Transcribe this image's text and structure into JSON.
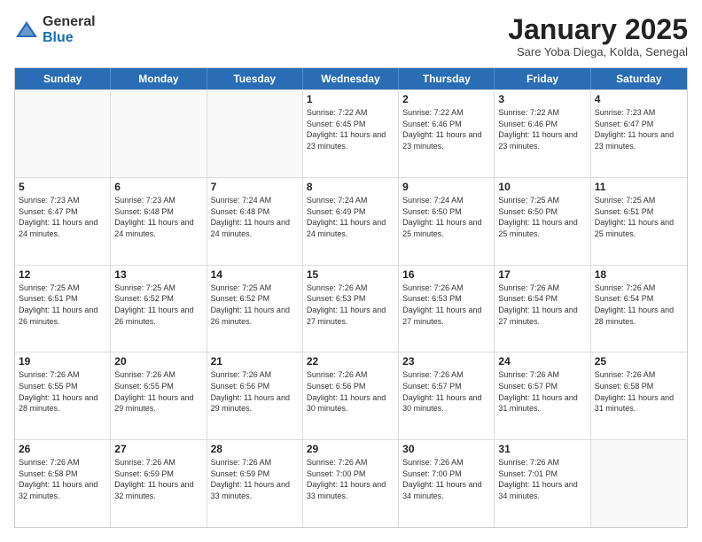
{
  "logo": {
    "general": "General",
    "blue": "Blue"
  },
  "header": {
    "title": "January 2025",
    "location": "Sare Yoba Diega, Kolda, Senegal"
  },
  "days": [
    "Sunday",
    "Monday",
    "Tuesday",
    "Wednesday",
    "Thursday",
    "Friday",
    "Saturday"
  ],
  "weeks": [
    [
      {
        "num": "",
        "info": ""
      },
      {
        "num": "",
        "info": ""
      },
      {
        "num": "",
        "info": ""
      },
      {
        "num": "1",
        "info": "Sunrise: 7:22 AM\nSunset: 6:45 PM\nDaylight: 11 hours and 23 minutes."
      },
      {
        "num": "2",
        "info": "Sunrise: 7:22 AM\nSunset: 6:46 PM\nDaylight: 11 hours and 23 minutes."
      },
      {
        "num": "3",
        "info": "Sunrise: 7:22 AM\nSunset: 6:46 PM\nDaylight: 11 hours and 23 minutes."
      },
      {
        "num": "4",
        "info": "Sunrise: 7:23 AM\nSunset: 6:47 PM\nDaylight: 11 hours and 23 minutes."
      }
    ],
    [
      {
        "num": "5",
        "info": "Sunrise: 7:23 AM\nSunset: 6:47 PM\nDaylight: 11 hours and 24 minutes."
      },
      {
        "num": "6",
        "info": "Sunrise: 7:23 AM\nSunset: 6:48 PM\nDaylight: 11 hours and 24 minutes."
      },
      {
        "num": "7",
        "info": "Sunrise: 7:24 AM\nSunset: 6:48 PM\nDaylight: 11 hours and 24 minutes."
      },
      {
        "num": "8",
        "info": "Sunrise: 7:24 AM\nSunset: 6:49 PM\nDaylight: 11 hours and 24 minutes."
      },
      {
        "num": "9",
        "info": "Sunrise: 7:24 AM\nSunset: 6:50 PM\nDaylight: 11 hours and 25 minutes."
      },
      {
        "num": "10",
        "info": "Sunrise: 7:25 AM\nSunset: 6:50 PM\nDaylight: 11 hours and 25 minutes."
      },
      {
        "num": "11",
        "info": "Sunrise: 7:25 AM\nSunset: 6:51 PM\nDaylight: 11 hours and 25 minutes."
      }
    ],
    [
      {
        "num": "12",
        "info": "Sunrise: 7:25 AM\nSunset: 6:51 PM\nDaylight: 11 hours and 26 minutes."
      },
      {
        "num": "13",
        "info": "Sunrise: 7:25 AM\nSunset: 6:52 PM\nDaylight: 11 hours and 26 minutes."
      },
      {
        "num": "14",
        "info": "Sunrise: 7:25 AM\nSunset: 6:52 PM\nDaylight: 11 hours and 26 minutes."
      },
      {
        "num": "15",
        "info": "Sunrise: 7:26 AM\nSunset: 6:53 PM\nDaylight: 11 hours and 27 minutes."
      },
      {
        "num": "16",
        "info": "Sunrise: 7:26 AM\nSunset: 6:53 PM\nDaylight: 11 hours and 27 minutes."
      },
      {
        "num": "17",
        "info": "Sunrise: 7:26 AM\nSunset: 6:54 PM\nDaylight: 11 hours and 27 minutes."
      },
      {
        "num": "18",
        "info": "Sunrise: 7:26 AM\nSunset: 6:54 PM\nDaylight: 11 hours and 28 minutes."
      }
    ],
    [
      {
        "num": "19",
        "info": "Sunrise: 7:26 AM\nSunset: 6:55 PM\nDaylight: 11 hours and 28 minutes."
      },
      {
        "num": "20",
        "info": "Sunrise: 7:26 AM\nSunset: 6:55 PM\nDaylight: 11 hours and 29 minutes."
      },
      {
        "num": "21",
        "info": "Sunrise: 7:26 AM\nSunset: 6:56 PM\nDaylight: 11 hours and 29 minutes."
      },
      {
        "num": "22",
        "info": "Sunrise: 7:26 AM\nSunset: 6:56 PM\nDaylight: 11 hours and 30 minutes."
      },
      {
        "num": "23",
        "info": "Sunrise: 7:26 AM\nSunset: 6:57 PM\nDaylight: 11 hours and 30 minutes."
      },
      {
        "num": "24",
        "info": "Sunrise: 7:26 AM\nSunset: 6:57 PM\nDaylight: 11 hours and 31 minutes."
      },
      {
        "num": "25",
        "info": "Sunrise: 7:26 AM\nSunset: 6:58 PM\nDaylight: 11 hours and 31 minutes."
      }
    ],
    [
      {
        "num": "26",
        "info": "Sunrise: 7:26 AM\nSunset: 6:58 PM\nDaylight: 11 hours and 32 minutes."
      },
      {
        "num": "27",
        "info": "Sunrise: 7:26 AM\nSunset: 6:59 PM\nDaylight: 11 hours and 32 minutes."
      },
      {
        "num": "28",
        "info": "Sunrise: 7:26 AM\nSunset: 6:59 PM\nDaylight: 11 hours and 33 minutes."
      },
      {
        "num": "29",
        "info": "Sunrise: 7:26 AM\nSunset: 7:00 PM\nDaylight: 11 hours and 33 minutes."
      },
      {
        "num": "30",
        "info": "Sunrise: 7:26 AM\nSunset: 7:00 PM\nDaylight: 11 hours and 34 minutes."
      },
      {
        "num": "31",
        "info": "Sunrise: 7:26 AM\nSunset: 7:01 PM\nDaylight: 11 hours and 34 minutes."
      },
      {
        "num": "",
        "info": ""
      }
    ]
  ]
}
